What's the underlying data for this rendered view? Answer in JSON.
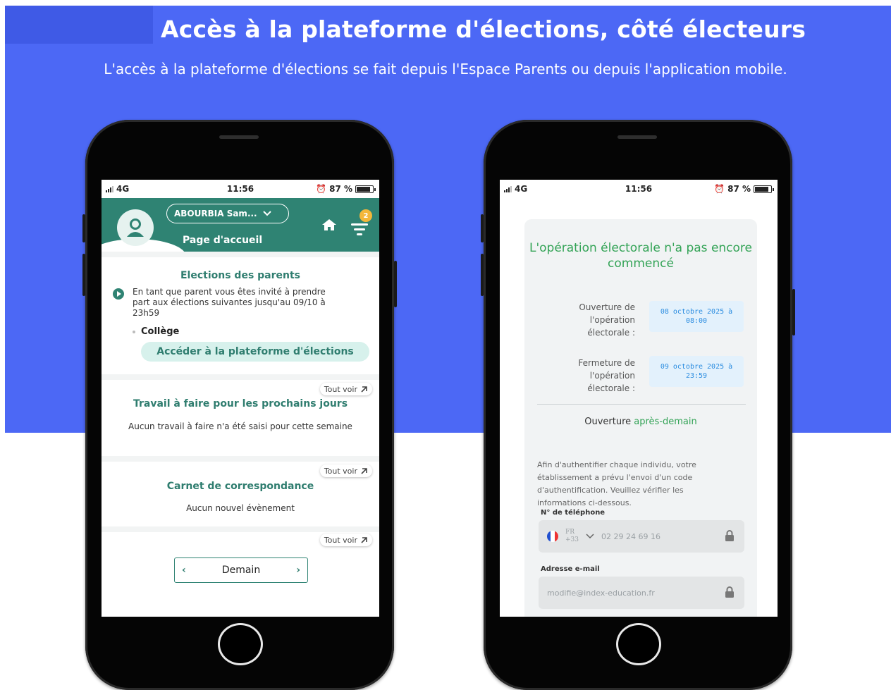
{
  "header": {
    "title": "Accès à la plateforme d'élections, côté électeurs",
    "subtitle": "L'accès à la plateforme d'élections se fait depuis l'Espace Parents ou depuis l'application mobile."
  },
  "colors": {
    "banner": "#4c68f5",
    "app_green": "#2f8373",
    "title_green": "#33a356",
    "date_blue": "#2c8de0"
  },
  "phone_left": {
    "status": {
      "network": "4G",
      "time": "11:56",
      "battery": "87 %"
    },
    "user_name": "ABOURBIA Sam...",
    "page_title": "Page d'accueil",
    "notification_count": "2",
    "elections": {
      "title": "Elections des parents",
      "info": "En tant que parent vous êtes invité à prendre part aux élections suivantes jusqu'au 09/10 à 23h59",
      "item": "Collège",
      "access_button": "Accéder à la plateforme d'élections"
    },
    "see_all_label": "Tout voir",
    "homework": {
      "title": "Travail à faire pour les prochains jours",
      "empty": "Aucun travail à faire n'a été saisi pour cette semaine"
    },
    "correspondence": {
      "title": "Carnet de correspondance",
      "empty": "Aucun nouvel évènement"
    },
    "day_nav": {
      "label": "Demain",
      "prev": "‹",
      "next": "›"
    }
  },
  "phone_right": {
    "status": {
      "network": "4G",
      "time": "11:56",
      "battery": "87 %"
    },
    "title": "L'opération électorale n'a pas encore commencé",
    "opening_label": "Ouverture de l'opération électorale :",
    "opening_date": "08 octobre 2025 à 08:00",
    "closing_label": "Fermeture de l'opération électorale :",
    "closing_date": "09 octobre 2025 à 23:59",
    "opening_prefix": "Ouverture",
    "opening_when": "après-demain",
    "auth_text": "Afin d'authentifier chaque individu, votre établissement a prévu l'envoi d'un code d'authentification. Veuillez vérifier les informations ci-dessous.",
    "phone_label": "N° de téléphone",
    "country_code": "FR",
    "dial_code": "+33",
    "phone_value": "02 29 24 69 16",
    "email_label": "Adresse e-mail",
    "email_value": "modifie@index-education.fr"
  }
}
